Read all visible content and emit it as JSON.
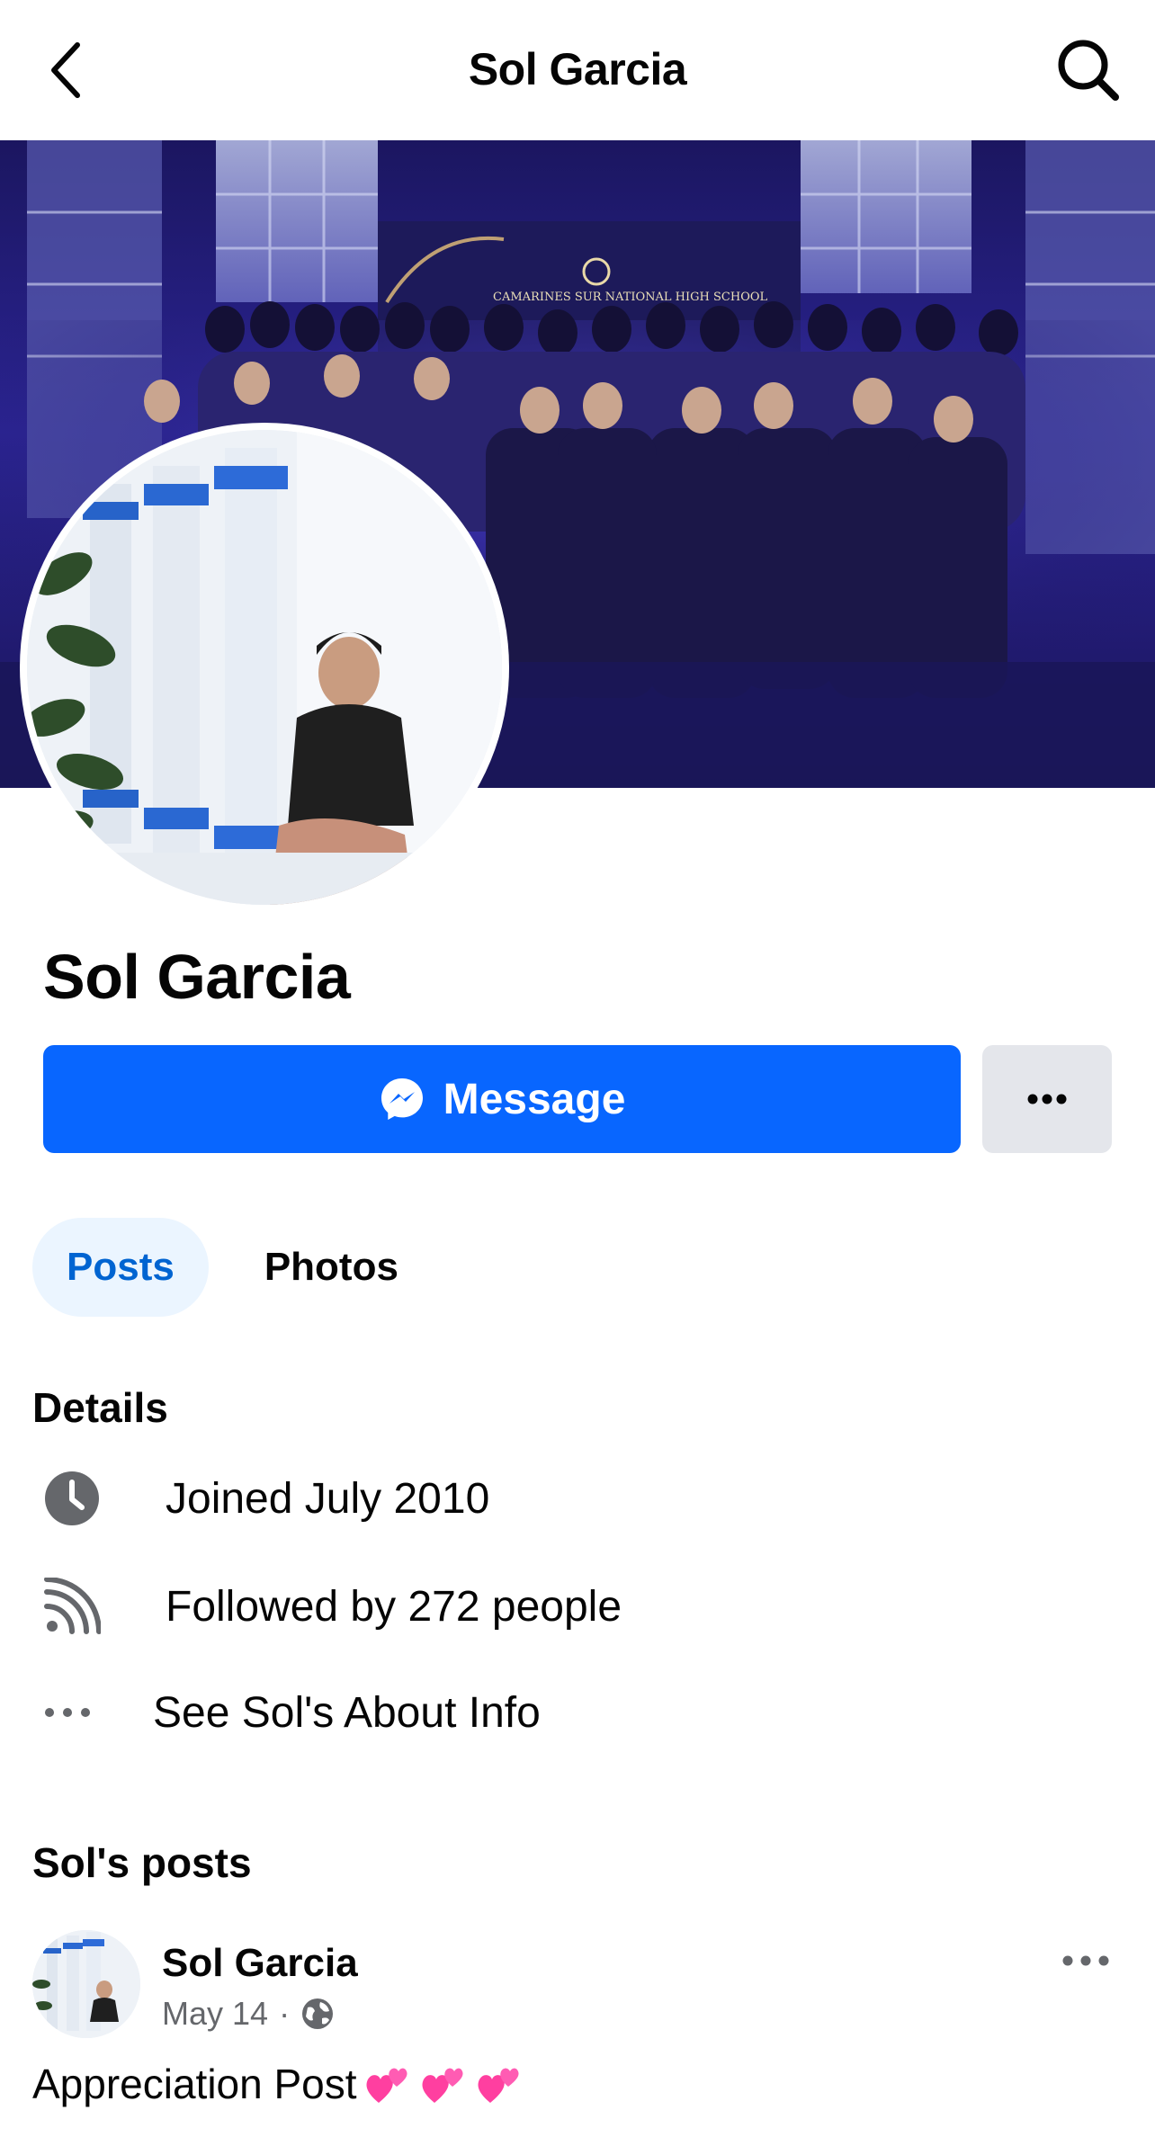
{
  "nav": {
    "title": "Sol Garcia",
    "back_icon": "chevron-left-icon",
    "search_icon": "search-icon"
  },
  "cover": {
    "banner_text": "CAMARINES SUR NATIONAL HIGH SCHOOL"
  },
  "profile": {
    "name": "Sol Garcia",
    "message_label": "Message",
    "message_icon": "messenger-icon",
    "more_icon": "more-dots-icon"
  },
  "tabs": [
    {
      "label": "Posts",
      "active": true
    },
    {
      "label": "Photos",
      "active": false
    }
  ],
  "details": {
    "title": "Details",
    "items": [
      {
        "icon": "clock-icon",
        "text": "Joined July 2010"
      },
      {
        "icon": "rss-icon",
        "text": "Followed by 272 people"
      },
      {
        "icon": "more-dots-icon",
        "text": "See Sol's About Info"
      }
    ]
  },
  "posts": {
    "title": "Sol's posts",
    "items": [
      {
        "author": "Sol Garcia",
        "date": "May 14",
        "separator": "·",
        "privacy_icon": "globe-icon",
        "text": "Appreciation Post",
        "emoji": "two-hearts-icon"
      }
    ]
  },
  "colors": {
    "brand_blue": "#0866ff",
    "tab_active_bg": "#ebf5ff",
    "tab_active_text": "#0064d1",
    "secondary_btn": "#e4e6eb",
    "muted_text": "#65676b"
  }
}
